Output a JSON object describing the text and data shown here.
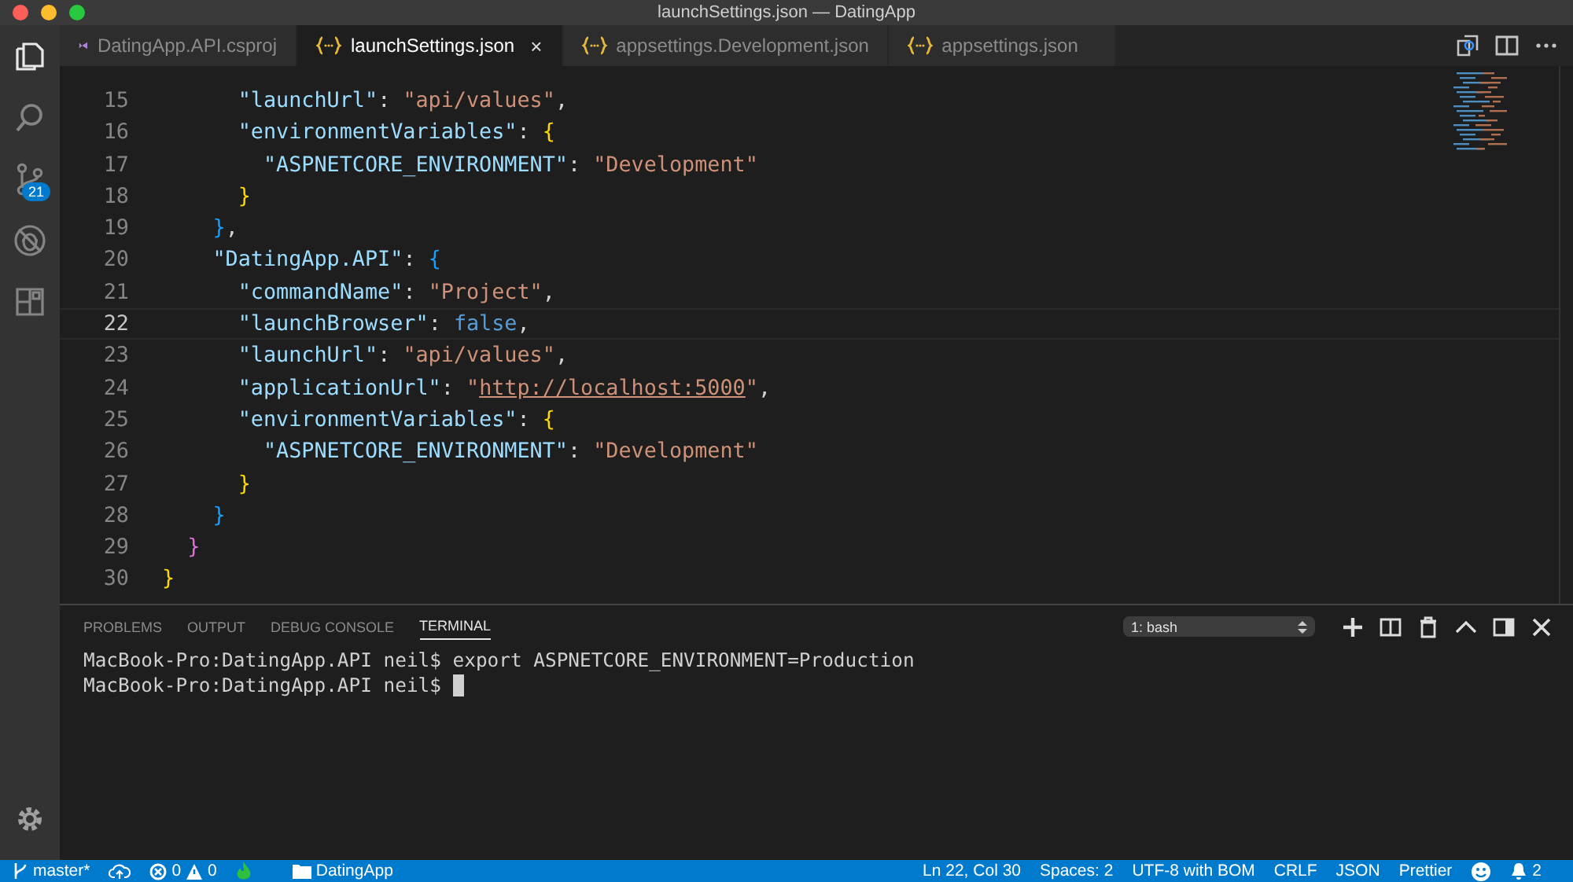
{
  "window": {
    "title": "launchSettings.json — DatingApp"
  },
  "activity_bar": {
    "items": [
      {
        "kind": "files",
        "selected": true
      },
      {
        "kind": "search",
        "selected": false
      },
      {
        "kind": "git",
        "selected": false,
        "badge": "21"
      },
      {
        "kind": "debug",
        "selected": false
      },
      {
        "kind": "extensions",
        "selected": false
      }
    ]
  },
  "tabs": [
    {
      "label": "DatingApp.API.csproj",
      "kind": "csproj",
      "selected": false
    },
    {
      "label": "launchSettings.json",
      "kind": "json",
      "selected": true,
      "close": "×"
    },
    {
      "label": "appsettings.Development.json",
      "kind": "json",
      "selected": false
    },
    {
      "label": "appsettings.json",
      "kind": "json",
      "selected": false
    }
  ],
  "editor": {
    "lines": [
      {
        "number": "15",
        "current": false,
        "tokens": [
          {
            "kind": "key",
            "text": "      \"launchUrl\""
          },
          {
            "kind": "punct",
            "text": ": "
          },
          {
            "kind": "str",
            "text": "\"api/values\""
          },
          {
            "kind": "punct",
            "text": ","
          }
        ]
      },
      {
        "number": "16",
        "current": false,
        "tokens": [
          {
            "kind": "key",
            "text": "      \"environmentVariables\""
          },
          {
            "kind": "punct",
            "text": ": "
          },
          {
            "kind": "brace1",
            "text": "{"
          }
        ]
      },
      {
        "number": "17",
        "current": false,
        "tokens": [
          {
            "kind": "key",
            "text": "        \"ASPNETCORE_ENVIRONMENT\""
          },
          {
            "kind": "punct",
            "text": ": "
          },
          {
            "kind": "str",
            "text": "\"Development\""
          }
        ]
      },
      {
        "number": "18",
        "current": false,
        "tokens": [
          {
            "kind": "brace1",
            "text": "      }"
          }
        ]
      },
      {
        "number": "19",
        "current": false,
        "tokens": [
          {
            "kind": "brace3",
            "text": "    }"
          },
          {
            "kind": "punct",
            "text": ","
          }
        ]
      },
      {
        "number": "20",
        "current": false,
        "tokens": [
          {
            "kind": "key",
            "text": "    \"DatingApp.API\""
          },
          {
            "kind": "punct",
            "text": ": "
          },
          {
            "kind": "brace3",
            "text": "{"
          }
        ]
      },
      {
        "number": "21",
        "current": false,
        "tokens": [
          {
            "kind": "key",
            "text": "      \"commandName\""
          },
          {
            "kind": "punct",
            "text": ": "
          },
          {
            "kind": "str",
            "text": "\"Project\""
          },
          {
            "kind": "punct",
            "text": ","
          }
        ]
      },
      {
        "number": "22",
        "current": true,
        "tokens": [
          {
            "kind": "key",
            "text": "      \"launchBrowser\""
          },
          {
            "kind": "punct",
            "text": ": "
          },
          {
            "kind": "bool",
            "text": "false"
          },
          {
            "kind": "punct",
            "text": ","
          }
        ]
      },
      {
        "number": "23",
        "current": false,
        "tokens": [
          {
            "kind": "key",
            "text": "      \"launchUrl\""
          },
          {
            "kind": "punct",
            "text": ": "
          },
          {
            "kind": "str",
            "text": "\"api/values\""
          },
          {
            "kind": "punct",
            "text": ","
          }
        ]
      },
      {
        "number": "24",
        "current": false,
        "tokens": [
          {
            "kind": "key",
            "text": "      \"applicationUrl\""
          },
          {
            "kind": "punct",
            "text": ": "
          },
          {
            "kind": "str",
            "text": "\""
          },
          {
            "kind": "link",
            "text": "http://localhost:5000"
          },
          {
            "kind": "str",
            "text": "\""
          },
          {
            "kind": "punct",
            "text": ","
          }
        ]
      },
      {
        "number": "25",
        "current": false,
        "tokens": [
          {
            "kind": "key",
            "text": "      \"environmentVariables\""
          },
          {
            "kind": "punct",
            "text": ": "
          },
          {
            "kind": "brace1",
            "text": "{"
          }
        ]
      },
      {
        "number": "26",
        "current": false,
        "tokens": [
          {
            "kind": "key",
            "text": "        \"ASPNETCORE_ENVIRONMENT\""
          },
          {
            "kind": "punct",
            "text": ": "
          },
          {
            "kind": "str",
            "text": "\"Development\""
          }
        ]
      },
      {
        "number": "27",
        "current": false,
        "tokens": [
          {
            "kind": "brace1",
            "text": "      }"
          }
        ]
      },
      {
        "number": "28",
        "current": false,
        "tokens": [
          {
            "kind": "brace3",
            "text": "    }"
          }
        ]
      },
      {
        "number": "29",
        "current": false,
        "tokens": [
          {
            "kind": "brace2",
            "text": "  }"
          }
        ]
      },
      {
        "number": "30",
        "current": false,
        "tokens": [
          {
            "kind": "brace1",
            "text": "}"
          }
        ]
      }
    ]
  },
  "panel": {
    "tabs": [
      {
        "label": "PROBLEMS",
        "selected": false
      },
      {
        "label": "OUTPUT",
        "selected": false
      },
      {
        "label": "DEBUG CONSOLE",
        "selected": false
      },
      {
        "label": "TERMINAL",
        "selected": true
      }
    ],
    "terminal_select": "1: bash",
    "terminal_lines": [
      "MacBook-Pro:DatingApp.API neil$ export ASPNETCORE_ENVIRONMENT=Production",
      "MacBook-Pro:DatingApp.API neil$ "
    ]
  },
  "status_bar": {
    "branch": "master*",
    "errors": "0",
    "warnings": "0",
    "folder": "DatingApp",
    "position": "Ln 22, Col 30",
    "spaces": "Spaces: 2",
    "encoding": "UTF-8 with BOM",
    "eol": "CRLF",
    "language": "JSON",
    "formatter": "Prettier",
    "notifications": "2"
  }
}
